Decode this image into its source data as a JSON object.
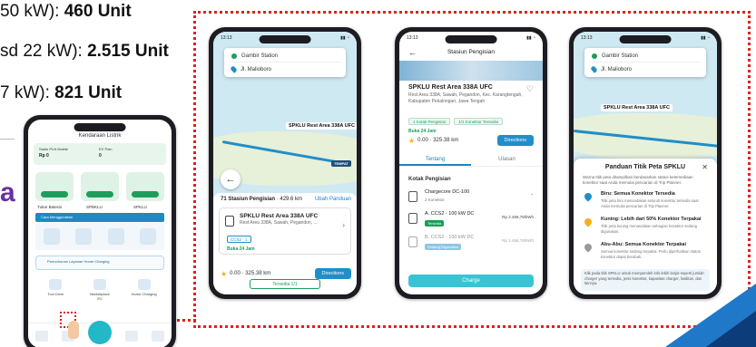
{
  "stats": [
    {
      "prefix": "50 kW): ",
      "value": "460 Unit"
    },
    {
      "prefix": "sd 22 kW): ",
      "value": "2.515 Unit"
    },
    {
      "prefix": "7 kW): ",
      "value": "821 Unit"
    }
  ],
  "side_letter": "a",
  "colors": {
    "frame": "#e02020",
    "accent": "#1f8ec9",
    "green": "#1d9d5b",
    "teal": "#38c4d4"
  },
  "phone1": {
    "time": "",
    "title": "Kendaraan Listrik",
    "saldo_label": "Saldo PLN Mobile",
    "saldo_value": "Rp 0",
    "ev_label": "EV Poin",
    "ev_value": "0",
    "tiles": [
      "Tukar Baterai",
      "SPBKLU",
      "SPKLU"
    ],
    "banner": "Cara Menggunakan",
    "service_text": "Permohonan Layanan Home Charging",
    "icons": [
      "Tool Drive",
      "Marketplace EV",
      "Home Charging"
    ]
  },
  "phone2": {
    "time": "13:13",
    "origin": "Gambir Station",
    "destination": "Jl. Malioboro",
    "map_label": "SPKLU Rest Area 338A UFC",
    "map_label_small": "TEMPAT",
    "list_count": "71 Stasiun Pengisian",
    "list_distance": "429.6 km",
    "list_link": "Ubah Panduan",
    "station_name": "SPKLU Rest Area 338A UFC",
    "station_addr": "Rest Area 338A, Sawah, Pegandon, ...",
    "chip": "CCS2 · 1",
    "hours": "Buka 24 Jam",
    "rating": "0.00",
    "distance": "325.38 km",
    "directions": "Directions",
    "bottom_link": "Tersedia 1/1"
  },
  "phone3": {
    "time": "13:13",
    "header": "Stasiun Pengisian",
    "title": "SPKLU Rest Area 338A UFC",
    "addr": "Rest Area 338A, Sawah, Pegandon, Kec. Karangtengah, Kabupaten Pekalongan, Jawa Tengah",
    "chip1": "1 Kotak Pengisian",
    "chip2": "1/1 Konektor Tersedia",
    "hours": "Buka 24 Jam",
    "rating": "0.00",
    "distance": "325.38 km",
    "directions": "Directions",
    "tab_active": "Tentang",
    "tab_other": "Ulasan",
    "section": "Kotak Pengisian",
    "group": "Chargecore DC-100",
    "group_sub": "2 Konektor",
    "conn1": "A. CCS2 - 100 kW DC",
    "conn1_tag": "Tersedia",
    "conn1_price": "Rp 2.466,78/kWh",
    "conn2": "B. CCS2 - 100 kW DC",
    "conn2_tag": "Sedang Digunakan",
    "conn2_price": "Rp 2.466,78/kWh",
    "button": "Charge"
  },
  "phone4": {
    "time": "13:13",
    "origin": "Gambir Station",
    "destination": "Jl. Malioboro",
    "map_label": "SPKLU Rest Area 338A UFC",
    "legend_title": "Panduan Titik Peta SPKLU",
    "legend_desc": "Warna titik peta ditampilkan berdasarkan status ketersediaan konektor saat Anda memulai pencarian di Trip Planner.",
    "items": [
      {
        "h": "Biru: Semua Konektor Tersedia",
        "d": "Titik peta biru menandakan seluruh konektor tersedia saat Anda memulai pencarian di Trip Planner.",
        "color": "#1f8ec9"
      },
      {
        "h": "Kuning: Lebih dari 50% Konektor Terpakai",
        "d": "Titik peta kuning menandakan sebagian konektor sedang digunakan.",
        "color": "#f2b01e"
      },
      {
        "h": "Abu-Abu: Semua Konektor Terpakai",
        "d": "Semua konektor sedang terpakai. Perlu diperhatikan status konektor dapat berubah.",
        "color": "#9a9a9a"
      }
    ],
    "foot": "Klik pada titik SPKLU untuk memperoleh info lebih lanjut seperti jumlah charger yang tersedia, jenis konektor, kapasitas charger, fasilitas, dan lainnya."
  }
}
